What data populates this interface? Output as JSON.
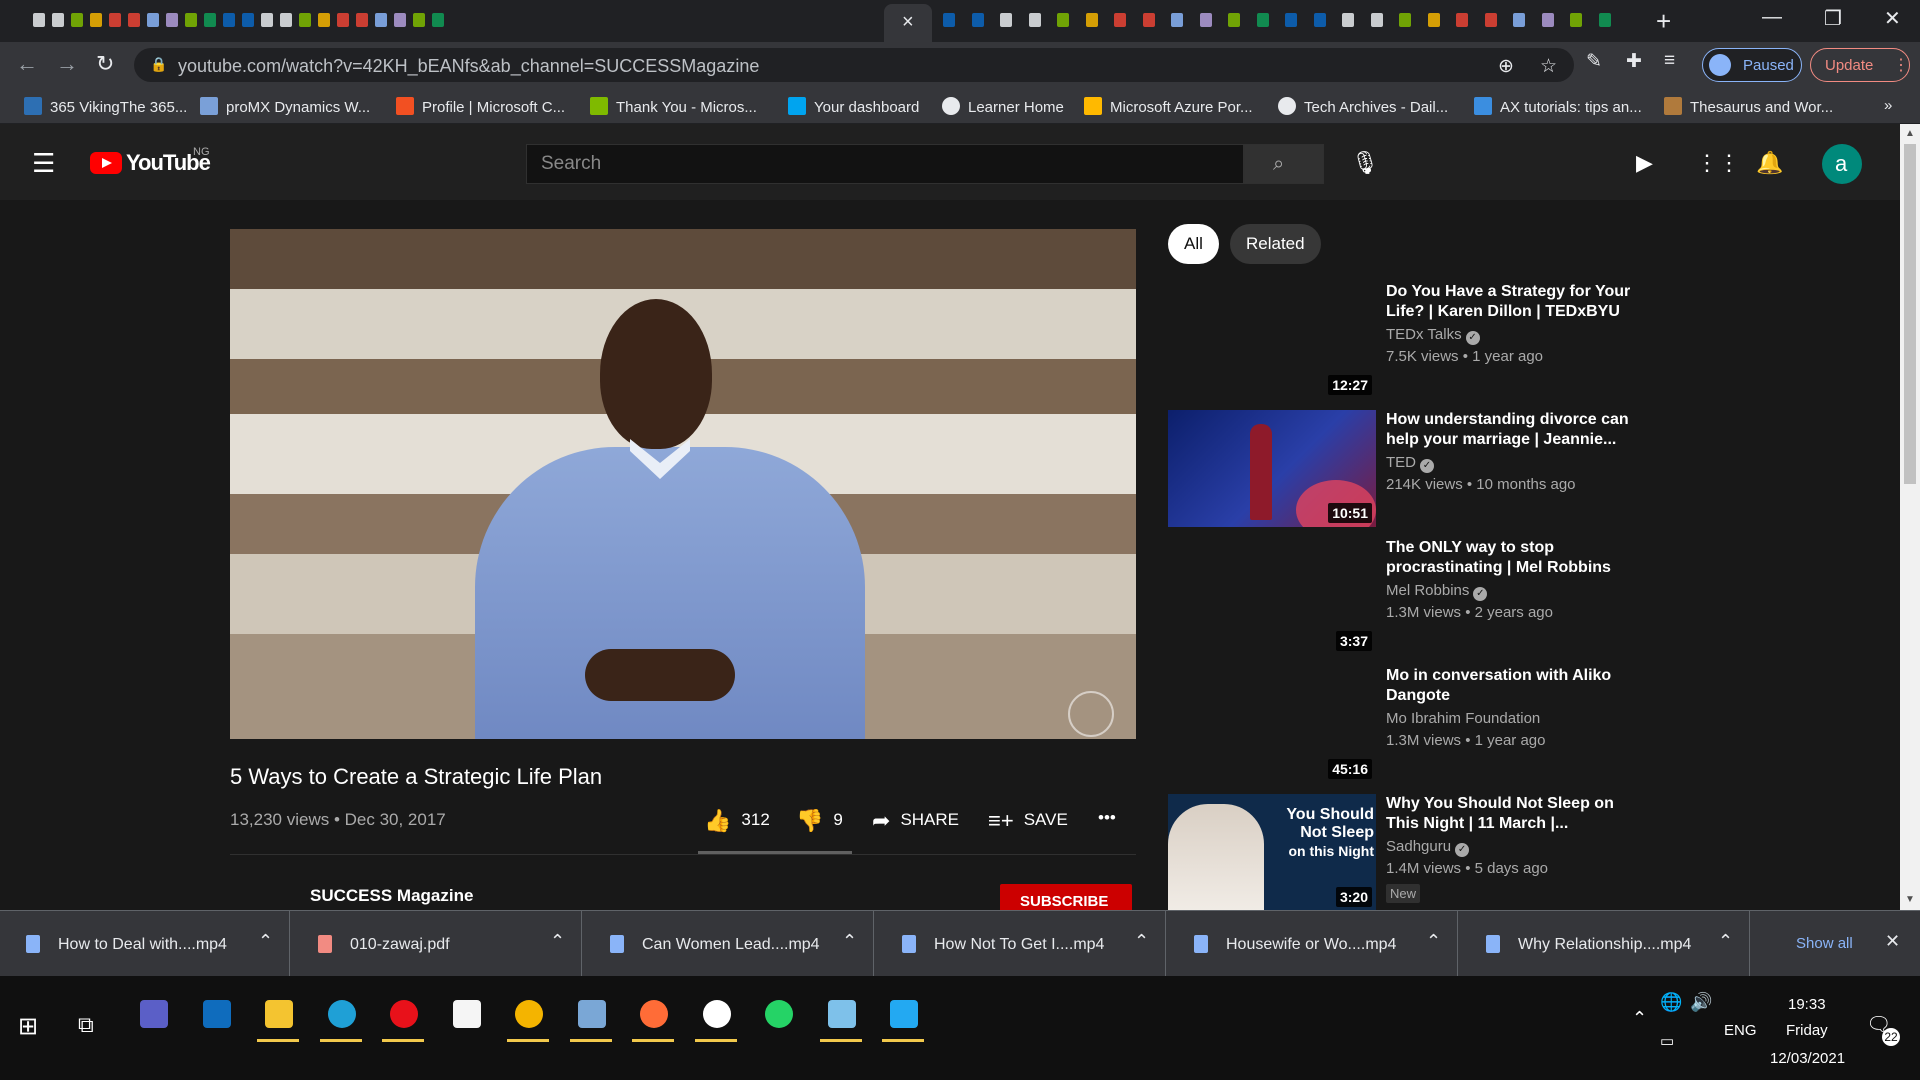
{
  "browser": {
    "active_tab_close": "×",
    "new_tab": "+",
    "window_controls": {
      "minimize": "—",
      "restore": "❐",
      "close": "✕"
    },
    "url": "youtube.com/watch?v=42KH_bEANfs&ab_channel=SUCCESSMagazine",
    "profile_status": "Paused",
    "update_label": "Update",
    "bookmarks": [
      {
        "label": "365 VikingThe 365...",
        "icon": "viking-icon",
        "color": "#2d6fb3"
      },
      {
        "label": "proMX Dynamics W...",
        "icon": "promx-icon",
        "color": "#7aa0d8"
      },
      {
        "label": "Profile | Microsoft C...",
        "icon": "microsoft-icon",
        "color": "#f25022"
      },
      {
        "label": "Thank You - Micros...",
        "icon": "microsoft-icon",
        "color": "#7fba00"
      },
      {
        "label": "Your dashboard",
        "icon": "microsoft-icon",
        "color": "#00a4ef"
      },
      {
        "label": "Learner Home",
        "icon": "globe-icon",
        "color": "#e8eaed"
      },
      {
        "label": "Microsoft Azure Por...",
        "icon": "microsoft-icon",
        "color": "#ffb900"
      },
      {
        "label": "Tech Archives - Dail...",
        "icon": "globe-icon",
        "color": "#e8eaed"
      },
      {
        "label": "AX tutorials: tips an...",
        "icon": "wordpress-icon",
        "color": "#3b8ee0"
      },
      {
        "label": "Thesaurus and Wor...",
        "icon": "thesaurus-icon",
        "color": "#b07a3c"
      }
    ],
    "bookmarks_overflow": "»"
  },
  "youtube": {
    "logo_text": "YouTube",
    "country_code": "NG",
    "search_placeholder": "Search",
    "avatar_letter": "a",
    "video": {
      "title": "5 Ways to Create a Strategic Life Plan",
      "meta": "13,230 views • Dec 30, 2017",
      "likes": "312",
      "dislikes": "9",
      "share_label": "SHARE",
      "save_label": "SAVE",
      "more_label": "•••"
    },
    "channel_name": "SUCCESS Magazine",
    "subscribe_label": "SUBSCRIBE",
    "chips": [
      "All",
      "Related"
    ],
    "related": [
      {
        "title": "Do You Have a Strategy for Your Life? | Karen Dillon | TEDxBYU",
        "channel": "TEDx Talks",
        "meta": "7.5K views • 1 year ago",
        "duration": "12:27",
        "badge": ""
      },
      {
        "title": "How understanding divorce can help your marriage | Jeannie...",
        "channel": "TED",
        "meta": "214K views • 10 months ago",
        "duration": "10:51",
        "badge": ""
      },
      {
        "title": "The ONLY way to stop procrastinating | Mel Robbins",
        "channel": "Mel Robbins",
        "meta": "1.3M views • 2 years ago",
        "duration": "3:37",
        "badge": ""
      },
      {
        "title": "Mo in conversation with Aliko Dangote",
        "channel": "Mo Ibrahim Foundation",
        "meta": "1.3M views • 1 year ago",
        "duration": "45:16",
        "badge": ""
      },
      {
        "title": "Why You Should Not Sleep on This Night | 11 March |...",
        "channel": "Sadhguru",
        "meta": "1.4M views • 5 days ago",
        "duration": "3:20",
        "badge": "New",
        "thumb_text": [
          "You Should",
          "Not Sleep",
          "on this Night"
        ]
      }
    ]
  },
  "downloads": {
    "items": [
      {
        "name": "How to Deal with....mp4",
        "type": "video"
      },
      {
        "name": "010-zawaj.pdf",
        "type": "pdf"
      },
      {
        "name": "Can Women Lead....mp4",
        "type": "video"
      },
      {
        "name": "How Not To Get I....mp4",
        "type": "video"
      },
      {
        "name": "Housewife or Wo....mp4",
        "type": "video"
      },
      {
        "name": "Why Relationship....mp4",
        "type": "video"
      }
    ],
    "show_all": "Show all",
    "close": "✕"
  },
  "taskbar": {
    "apps": [
      {
        "name": "teams-icon",
        "color": "#5b5fc7"
      },
      {
        "name": "outlook-icon",
        "color": "#0f6cbd"
      },
      {
        "name": "file-explorer-icon",
        "color": "#f4c430"
      },
      {
        "name": "edge-icon",
        "color": "#1fa0d6"
      },
      {
        "name": "opera-icon",
        "color": "#e8111a"
      },
      {
        "name": "notepad-icon",
        "color": "#f5f5f5"
      },
      {
        "name": "chrome-icon",
        "color": "#f4b400"
      },
      {
        "name": "remote-desktop-icon",
        "color": "#7aa7d6"
      },
      {
        "name": "postman-icon",
        "color": "#ff6c37"
      },
      {
        "name": "app-green-icon",
        "color": "#ffffff"
      },
      {
        "name": "whatsapp-icon",
        "color": "#25d366"
      },
      {
        "name": "notes-icon",
        "color": "#7ec1ea"
      },
      {
        "name": "vscode-icon",
        "color": "#23a9f2"
      }
    ],
    "language": "ENG",
    "time": "19:33",
    "day": "Friday",
    "date": "12/03/2021",
    "notification_count": "22"
  }
}
